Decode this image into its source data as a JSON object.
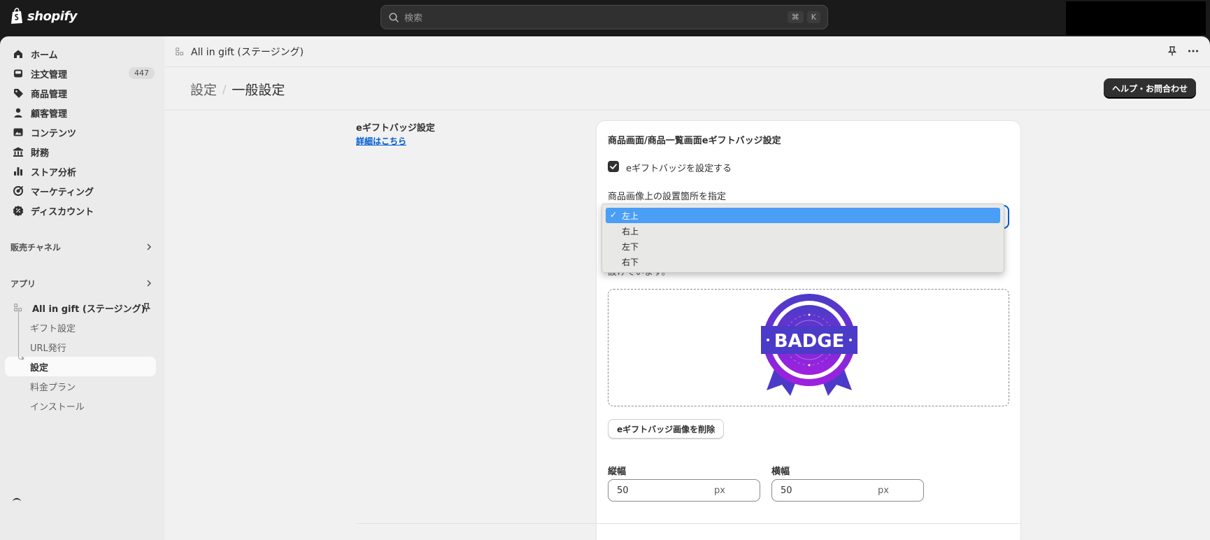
{
  "topbar": {
    "logo_text": "shopify",
    "search_placeholder": "検索",
    "shortcut_cmd": "⌘",
    "shortcut_key": "K"
  },
  "sidebar": {
    "items": [
      {
        "label": "ホーム",
        "icon": "home-icon"
      },
      {
        "label": "注文管理",
        "icon": "inbox-icon",
        "badge": "447"
      },
      {
        "label": "商品管理",
        "icon": "tag-icon"
      },
      {
        "label": "顧客管理",
        "icon": "person-icon"
      },
      {
        "label": "コンテンツ",
        "icon": "image-icon"
      },
      {
        "label": "財務",
        "icon": "bank-icon"
      },
      {
        "label": "ストア分析",
        "icon": "bar-chart-icon"
      },
      {
        "label": "マーケティング",
        "icon": "target-icon"
      },
      {
        "label": "ディスカウント",
        "icon": "discount-icon"
      }
    ],
    "sales_channels": "販売チャネル",
    "apps": "アプリ",
    "app_name": "All in gift (ステージング)",
    "app_sub": [
      {
        "label": "ギフト設定"
      },
      {
        "label": "URL発行"
      },
      {
        "label": "設定"
      },
      {
        "label": "料金プラン"
      },
      {
        "label": "インストール"
      }
    ]
  },
  "header": {
    "app_title": "All in gift (ステージング)"
  },
  "page": {
    "crumb_parent": "設定",
    "crumb_sep": "/",
    "crumb_current": "一般設定",
    "help_label": "ヘルプ・お問合わせ"
  },
  "section": {
    "title": "eギフトバッジ設定",
    "link": "詳細はこちら"
  },
  "card": {
    "title": "商品画面/商品一覧画面eギフトバッジ設定",
    "checkbox_label": "eギフトバッジを設定する",
    "position_label": "商品画像上の設置箇所を指定",
    "desc_line2": "設けています。",
    "badge_text": "BADGE",
    "delete_label": "eギフトバッジ画像を削除",
    "height_label": "縦幅",
    "height_value": "50",
    "width_label": "横幅",
    "width_value": "50",
    "unit": "px"
  },
  "dropdown": {
    "options": [
      "左上",
      "右上",
      "左下",
      "右下"
    ],
    "selected_index": 0,
    "check": "✓"
  },
  "colors": {
    "accent": "#005bd3",
    "select_highlight": "#4a9ef5",
    "badge_purple": "#7b2bd6",
    "badge_blue": "#4b3bc8"
  }
}
